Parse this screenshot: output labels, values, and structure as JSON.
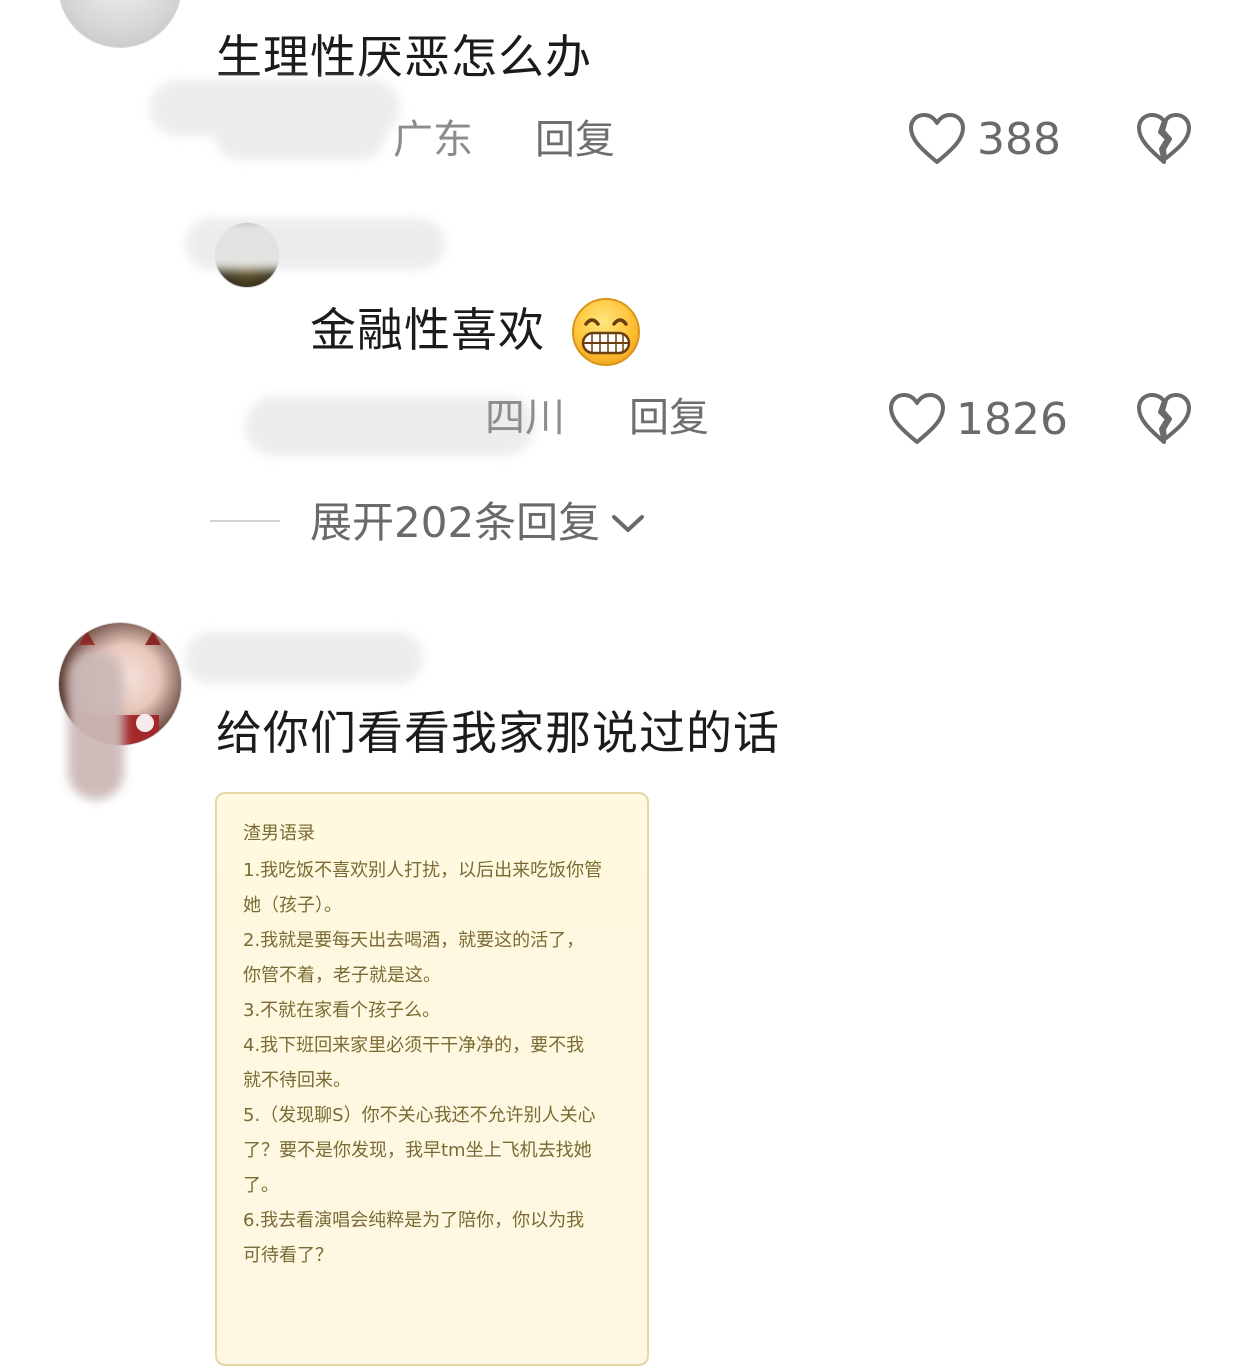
{
  "comments": [
    {
      "text": "生理性厌恶怎么办",
      "location": "广东",
      "reply_label": "回复",
      "likes": "388"
    }
  ],
  "reply": {
    "text": "金融性喜欢",
    "emoji": "grin-emoji",
    "location": "四川",
    "reply_label": "回复",
    "likes": "1826"
  },
  "expand": {
    "label": "展开202条回复"
  },
  "comment2": {
    "text": "给你们看看我家那说过的话",
    "note": {
      "title": "渣男语录",
      "lines": [
        "1.我吃饭不喜欢别人打扰，以后出来吃饭你管",
        "她（孩子）。",
        "2.我就是要每天出去喝酒，就要这的活了，",
        "你管不着，老子就是这。",
        "3.不就在家看个孩子么。",
        "4.我下班回来家里必须干干净净的，要不我",
        "就不待回来。",
        "5.（发现聊S）你不关心我还不允许别人关心",
        "了？要不是你发现，我早tm坐上飞机去找她",
        "了。",
        "6.我去看演唱会纯粹是为了陪你，你以为我",
        "可待看了？"
      ]
    }
  },
  "icons": {
    "like": "heart-outline-icon",
    "dislike": "broken-heart-icon",
    "expand": "chevron-down-icon"
  }
}
